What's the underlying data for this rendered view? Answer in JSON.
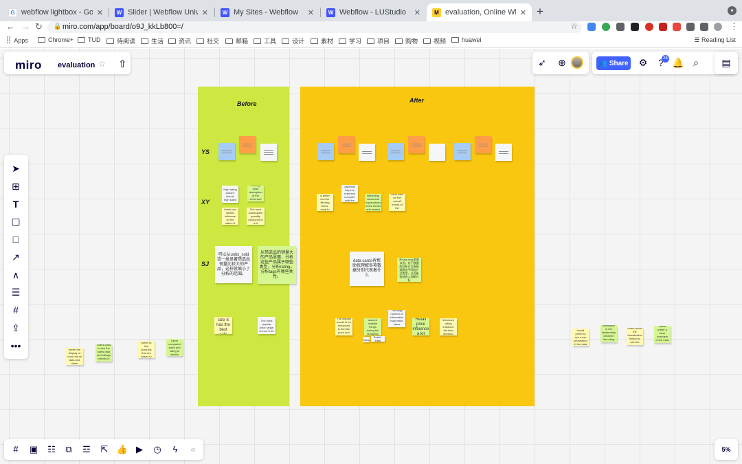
{
  "browser": {
    "tabs": [
      {
        "title": "webflow lightbox - Google Search",
        "icon": "google-icon",
        "favcolor": "#4285f4",
        "favtext": "G"
      },
      {
        "title": "Slider | Webflow University",
        "icon": "webflow-icon",
        "favcolor": "#4353ff",
        "favtext": "W"
      },
      {
        "title": "My Sites - Webflow",
        "icon": "webflow-icon",
        "favcolor": "#4353ff",
        "favtext": "W"
      },
      {
        "title": "Webflow - LUStudio",
        "icon": "webflow-icon",
        "favcolor": "#4353ff",
        "favtext": "W"
      },
      {
        "title": "evaluation, Online Whiteboard for V",
        "icon": "miro-icon",
        "favcolor": "#ffd02f",
        "favtext": "M"
      }
    ],
    "url": "miro.com/app/board/o9J_kkLb800=/",
    "bookmarks": [
      "Apps",
      "Chrome+",
      "TUD",
      "待阅读",
      "生活",
      "资讯",
      "社交",
      "邮箱",
      "工具",
      "设计",
      "素材",
      "学习",
      "项目",
      "购物",
      "视频",
      "huawei"
    ],
    "reading_list": "Reading List"
  },
  "miro": {
    "logo": "miro",
    "board_name": "evaluation",
    "share_label": "Share",
    "notification_count": "26",
    "zoom": "5%",
    "colors": {
      "accent": "#4262ff",
      "before_frame": "#cee741",
      "after_frame": "#fac710"
    }
  },
  "board": {
    "before_title": "Before",
    "after_title": "After",
    "row_labels": [
      "YS",
      "XY",
      "SJ"
    ],
    "before_notes": [
      {
        "text": "High rating doesn't lead to high sales",
        "color": "w"
      },
      {
        "text": "lacking clear description of the trend and feature",
        "color": "g"
      },
      {
        "text": "sold cost items has limited influence on the sales of products",
        "color": "y"
      },
      {
        "text": "The most subsequent quantity product buy in it",
        "color": "y"
      },
      {
        "text": "可以从units_sold这一类显著筛选出销量比较大的产品，这样就缩小了分析的范围。",
        "color": "w"
      },
      {
        "text": "从筛选出的销量大的产品里面，分析这些产品属于哪些类型，分析rating，分析tags有哪些共性。",
        "color": "g"
      },
      {
        "text": "The size S has the best sale",
        "color": "y"
      },
      {
        "text": "The most popular price range is from 5-10",
        "color": "w"
      }
    ],
    "after_notes": [
      {
        "text": "Clear color & better icon for filtering items, easy to find",
        "color": "y"
      },
      {
        "text": "Use data card that helps to read and compare with the other",
        "color": "w"
      },
      {
        "text": "The most interesting views and explanations of the trends and related information",
        "color": "g"
      },
      {
        "text": "The most clear data for the overall trends of the category and rating",
        "color": "y"
      },
      {
        "text": "data cards有帮助我理解各项数据分别代表着什么",
        "color": "w"
      },
      {
        "text": "在data map里面口述，对于数据的分析可以直接观察出不同的产品类型，从而更快地进入判断分析",
        "color": "g"
      },
      {
        "text": "The display needs to be enhanced to find the price and size trends",
        "color": "y"
      },
      {
        "text": "Users wanted multiple things during the shopping process",
        "color": "g"
      },
      {
        "text": "The large number of information may make users confused",
        "color": "w"
      },
      {
        "text": "Retail price influence a lot",
        "color": "g"
      },
      {
        "text": "Merchant rating influence the final decision",
        "color": "y"
      },
      {
        "text": "Rating",
        "color": "w"
      },
      {
        "text": "Retail - High",
        "color": "w"
      }
    ],
    "outside_notes": [
      {
        "text": "Users prefer the display of more visual data and richer information",
        "color": "y"
      },
      {
        "text": "Users want to see the sales data and ratings directly in the chart",
        "color": "g"
      },
      {
        "text": "Users prefer to find products that are easier to understand",
        "color": "y"
      },
      {
        "text": "Users compared sales and rating to decide",
        "color": "g"
      },
      {
        "text": "The user would prefer to see more information in the data card",
        "color": "y"
      },
      {
        "text": "Users are interested in the relationship between the rating and sales of products",
        "color": "g"
      },
      {
        "text": "Users found the visualisation helpful to see the trends",
        "color": "y"
      },
      {
        "text": "Users prefer a clear overview of the main categories",
        "color": "g"
      }
    ]
  }
}
